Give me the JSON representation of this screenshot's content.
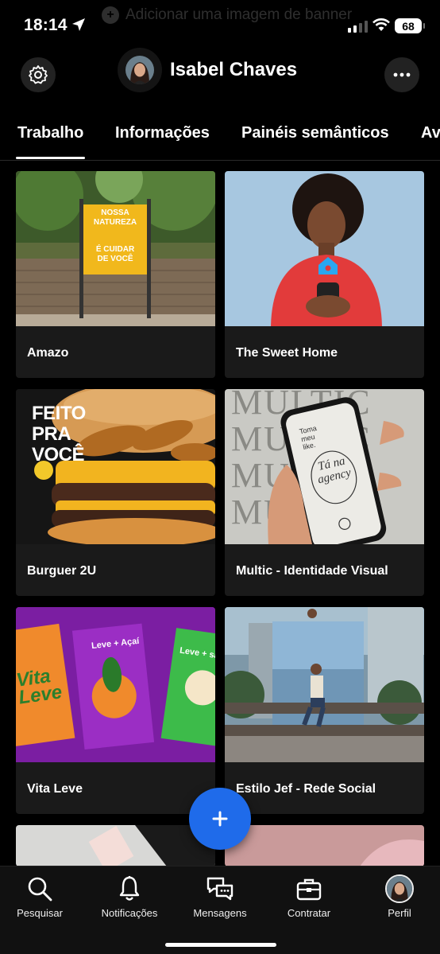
{
  "status": {
    "time": "18:14",
    "battery": "68"
  },
  "banner_hint": "Adicionar uma imagem de banner",
  "profile": {
    "name": "Isabel Chaves"
  },
  "tabs": [
    {
      "label": "Trabalho",
      "active": true
    },
    {
      "label": "Informações"
    },
    {
      "label": "Painéis semânticos"
    },
    {
      "label": "Av"
    }
  ],
  "projects": [
    {
      "title": "Amazo",
      "poster_lines": [
        "NOSSA",
        "NATUREZA",
        "É CUIDAR",
        "DE VOCÊ"
      ]
    },
    {
      "title": "The Sweet Home"
    },
    {
      "title": "Burguer 2U",
      "overlay_lines": [
        "FEITO",
        "PRA",
        "VOCÊ"
      ]
    },
    {
      "title": "Multic - Identidade Visual",
      "bg_words": [
        "MULTIC",
        "MULTIC",
        "MULTIC",
        "MULTIC"
      ],
      "phone_text": [
        "Toma",
        "meu",
        "like.",
        "Tá na",
        "agency"
      ]
    },
    {
      "title": "Vita Leve",
      "poster_texts": [
        "Vita",
        "Leve",
        "Leve + Açaí",
        "Leve + sa"
      ]
    },
    {
      "title": "Estilo Jef - Rede Social"
    }
  ],
  "nav": [
    {
      "label": "Pesquisar",
      "icon": "search-icon"
    },
    {
      "label": "Notificações",
      "icon": "bell-icon"
    },
    {
      "label": "Mensagens",
      "icon": "messages-icon"
    },
    {
      "label": "Contratar",
      "icon": "briefcase-icon"
    },
    {
      "label": "Perfil",
      "icon": "avatar"
    }
  ],
  "colors": {
    "accent": "#1f6bea",
    "background": "#000000",
    "card": "#1a1a1a"
  }
}
